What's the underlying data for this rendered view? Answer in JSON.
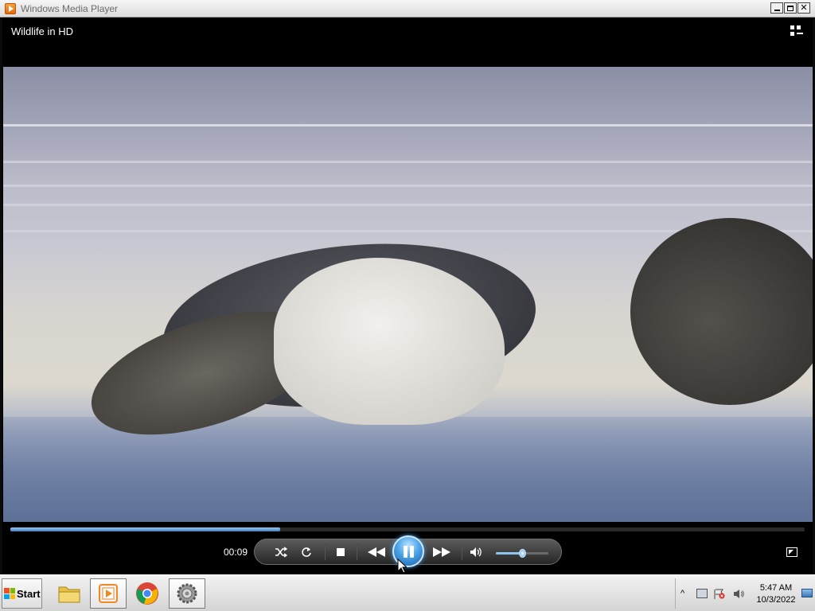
{
  "window": {
    "title": "Windows Media Player",
    "minimize_label": "",
    "close_label": "✕"
  },
  "player": {
    "now_playing": "Wildlife in HD",
    "elapsed": "00:09",
    "progress_fraction": 0.34,
    "volume_fraction": 0.5,
    "state": "playing"
  },
  "controls": {
    "shuffle_icon": "shuffle-icon",
    "repeat_icon": "repeat-icon",
    "stop_icon": "stop-icon",
    "previous_icon": "previous-icon",
    "pause_icon": "pause-icon",
    "next_icon": "next-icon",
    "mute_icon": "speaker-icon",
    "fullscreen_icon": "fullscreen-icon"
  },
  "taskbar": {
    "start_label": "Start",
    "pinned": [
      "folder-icon",
      "media-player-icon",
      "chrome-icon",
      "settings-gear-icon"
    ],
    "clock_time": "5:47 AM",
    "clock_date": "10/3/2022"
  },
  "colors": {
    "accent": "#4aa3e8",
    "seek_fill": "#3f7fc1",
    "player_bg": "#000000"
  }
}
